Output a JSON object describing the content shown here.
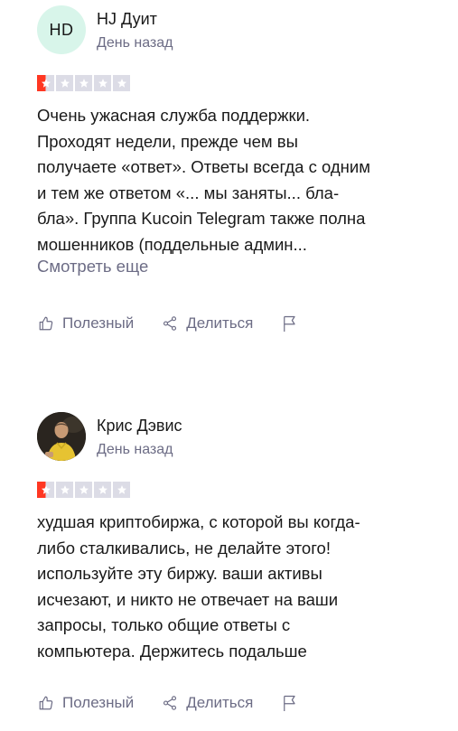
{
  "reviews": [
    {
      "user": {
        "initials": "HD",
        "name": "HJ Дуит",
        "avatar_color": "#d8f5ea"
      },
      "date": "День назад",
      "rating": 1,
      "rating_max": 5,
      "star_color": "#ff3722",
      "text_lines": [
        "Очень ужасная служба поддержки.",
        "Проходят недели, прежде чем вы",
        "получаете «ответ». Ответы всегда с одним",
        "и тем же ответом «... мы заняты... бла-",
        "бла». Группа Kucoin Telegram также полна",
        "мошенников (поддельные админ..."
      ],
      "see_more": "Смотреть еще",
      "actions": {
        "useful": "Полезный",
        "share": "Делиться",
        "useful_icon": "thumbs-up-icon",
        "share_icon": "share-icon",
        "flag_icon": "flag-icon"
      }
    },
    {
      "user": {
        "name": "Крис Дэвис",
        "avatar": "user-photo"
      },
      "date": "День назад",
      "rating": 1,
      "rating_max": 5,
      "star_color": "#ff3722",
      "text_lines": [
        "худшая криптобиржа, с которой вы когда-",
        "либо сталкивались, не делайте этого!",
        "используйте эту биржу. ваши активы",
        "исчезают, и никто не отвечает на ваши",
        "запросы, только общие ответы с",
        "компьютера. Держитесь подальше"
      ],
      "actions": {
        "useful": "Полезный",
        "share": "Делиться",
        "useful_icon": "thumbs-up-icon",
        "share_icon": "share-icon",
        "flag_icon": "flag-icon"
      }
    }
  ]
}
